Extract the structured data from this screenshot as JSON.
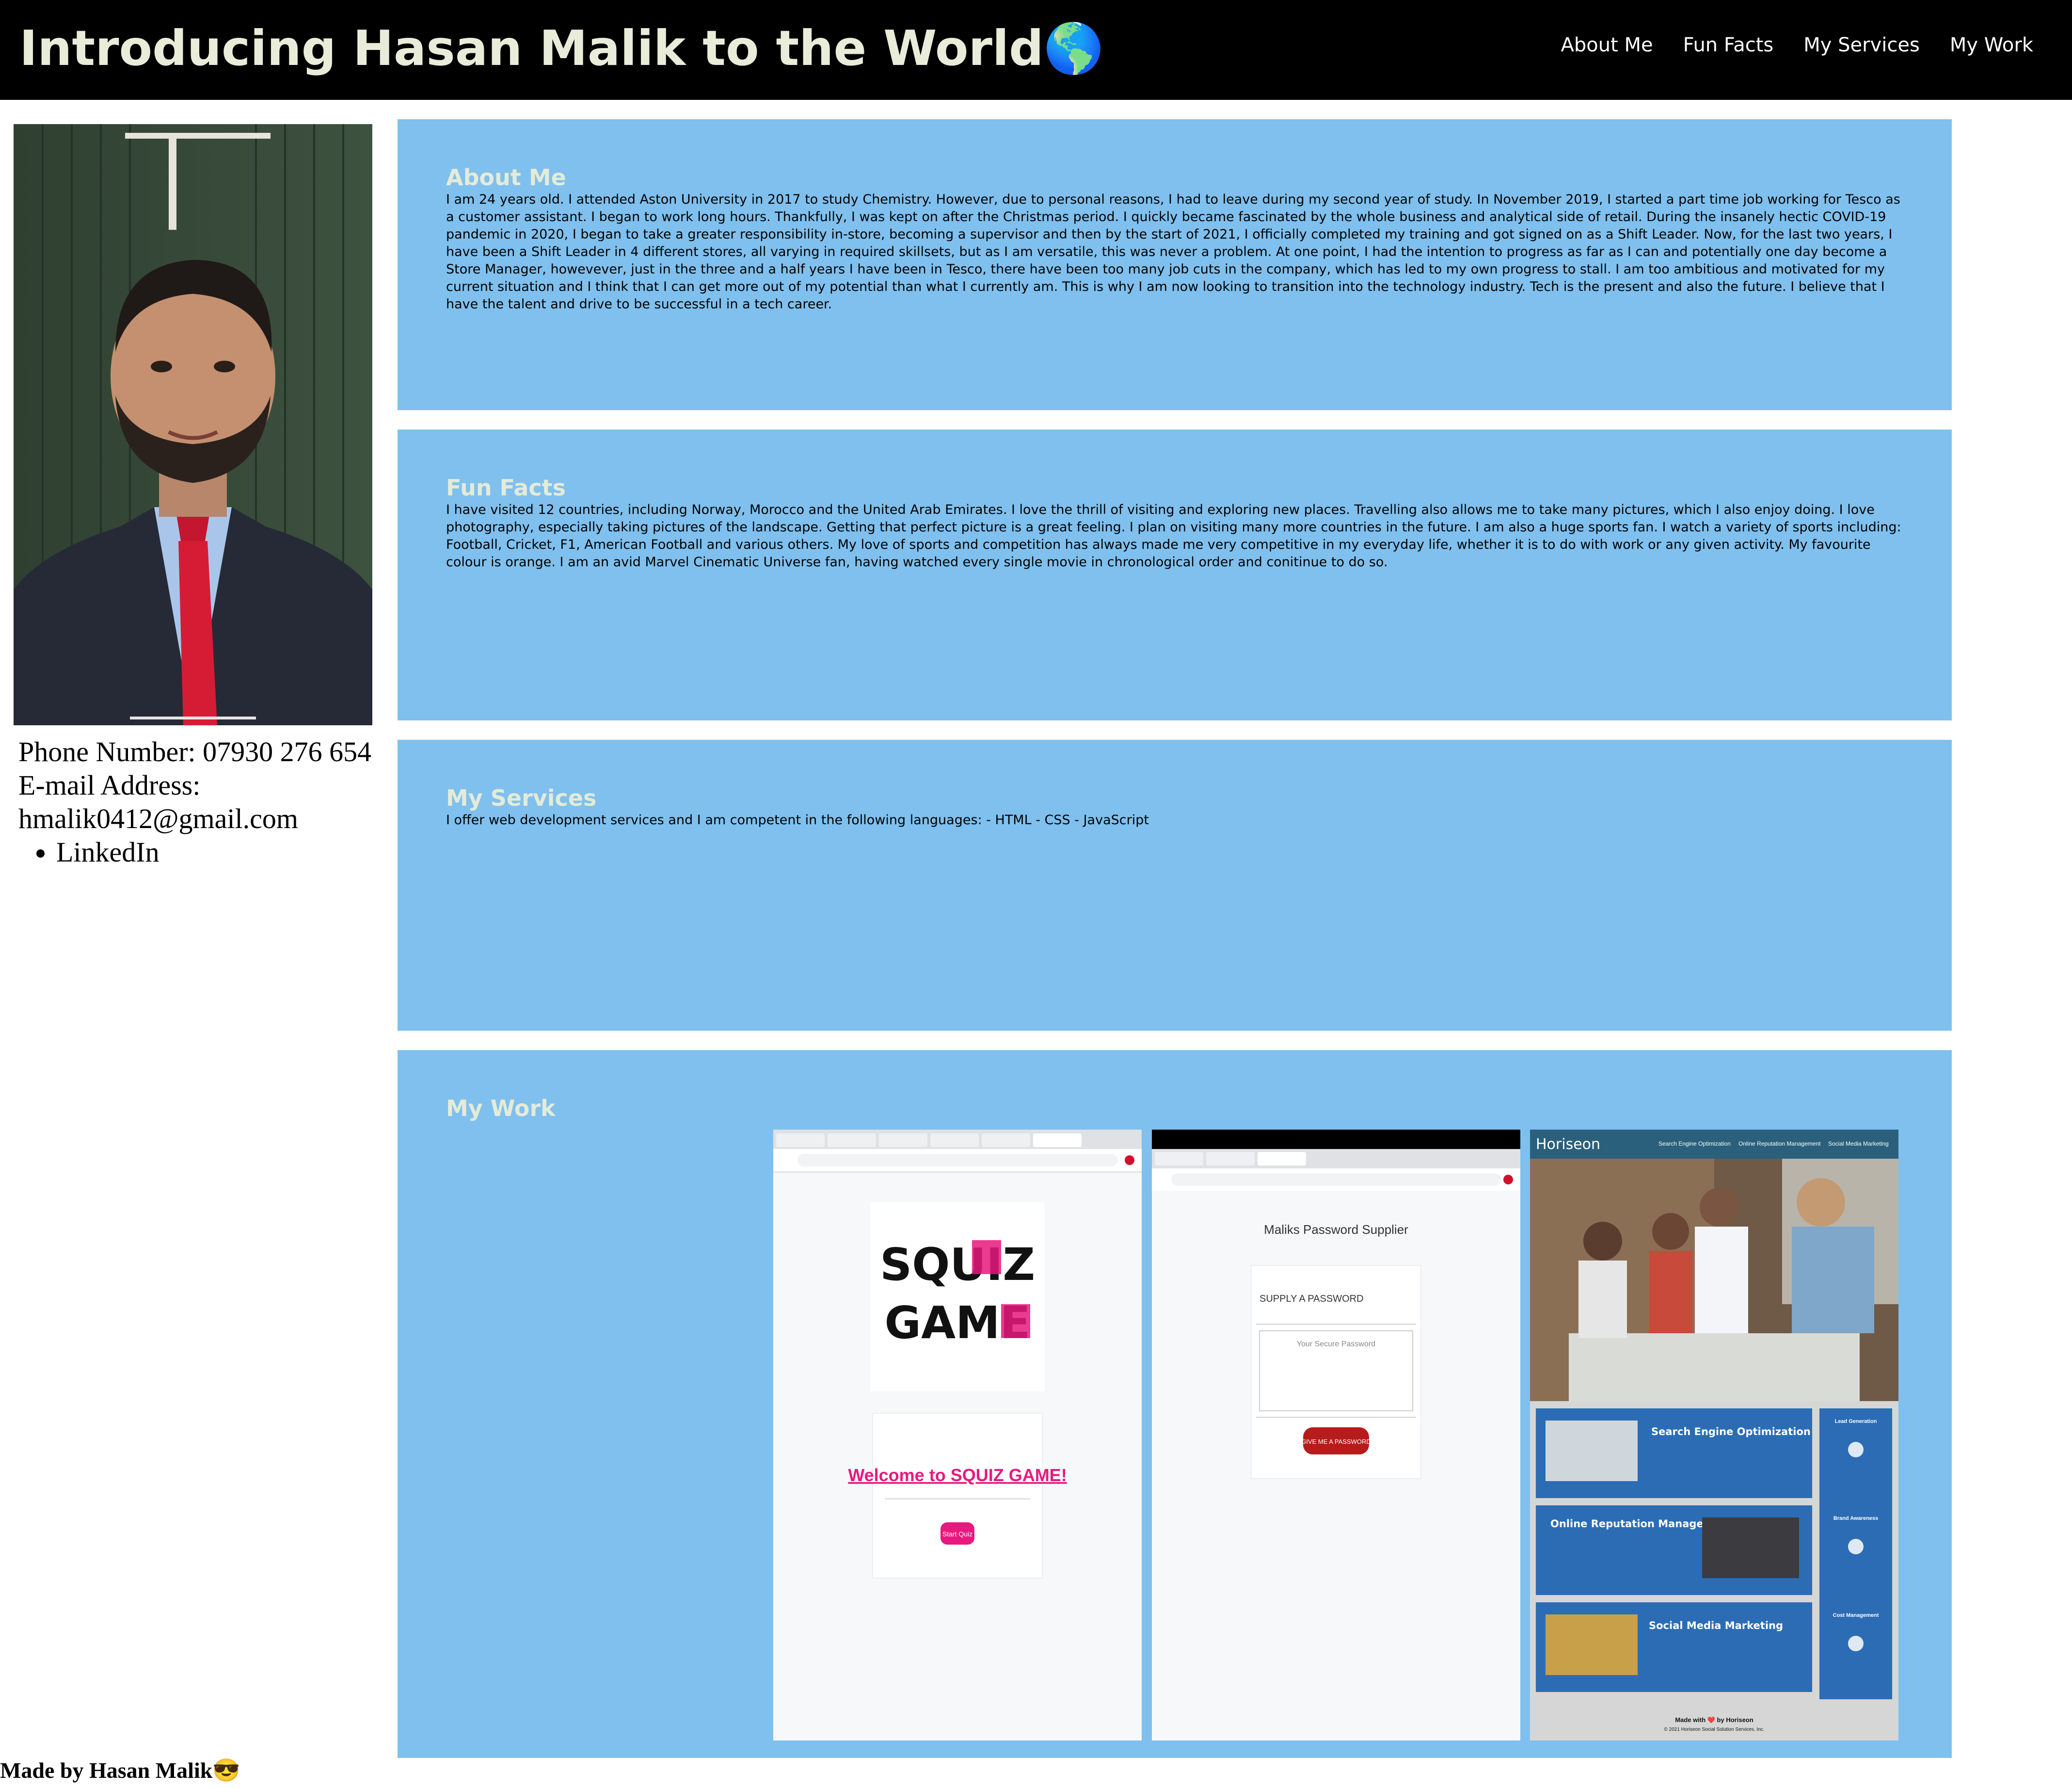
{
  "header": {
    "title": "Introducing Hasan Malik to the World🌎",
    "nav": [
      "About Me",
      "Fun Facts",
      "My Services",
      "My Work"
    ]
  },
  "sidebar": {
    "contact_text": "Phone Number: 07930 276 654 E-mail Address: hmalik0412@gmail.com",
    "links": [
      "LinkedIn"
    ]
  },
  "sections": {
    "about": {
      "heading": "About Me",
      "text": "I am 24 years old. I attended Aston University in 2017 to study Chemistry. However, due to personal reasons, I had to leave during my second year of study. In November 2019, I started a part time job working for Tesco as a customer assistant. I began to work long hours. Thankfully, I was kept on after the Christmas period. I quickly became fascinated by the whole business and analytical side of retail. During the insanely hectic COVID-19 pandemic in 2020, I began to take a greater responsibility in-store, becoming a supervisor and then by the start of 2021, I officially completed my training and got signed on as a Shift Leader. Now, for the last two years, I have been a Shift Leader in 4 different stores, all varying in required skillsets, but as I am versatile, this was never a problem. At one point, I had the intention to progress as far as I can and potentially one day become a Store Manager, howevever, just in the three and a half years I have been in Tesco, there have been too many job cuts in the company, which has led to my own progress to stall. I am too ambitious and motivated for my current situation and I think that I can get more out of my potential than what I currently am. This is why I am now looking to transition into the technology industry. Tech is the present and also the future. I believe that I have the talent and drive to be successful in a tech career."
    },
    "facts": {
      "heading": "Fun Facts",
      "text": "I have visited 12 countries, including Norway, Morocco and the United Arab Emirates. I love the thrill of visiting and exploring new places. Travelling also allows me to take many pictures, which I also enjoy doing. I love photography, especially taking pictures of the landscape. Getting that perfect picture is a great feeling. I plan on visiting many more countries in the future. I am also a huge sports fan. I watch a variety of sports including: Football, Cricket, F1, American Football and various others. My love of sports and competition has always made me very competitive in my everyday life, whether it is to do with work or any given activity. My favourite colour is orange. I am an avid Marvel Cinematic Universe fan, having watched every single movie in chronological order and conitinue to do so."
    },
    "services": {
      "heading": "My Services",
      "text": "I offer web development services and I am competent in the following languages: - HTML - CSS - JavaScript"
    },
    "work": {
      "heading": "My Work"
    }
  },
  "work_thumbs": {
    "squiz": {
      "logo_line1": "SQUIZ",
      "logo_line2": "GAME",
      "welcome": "Welcome to SQUIZ GAME!",
      "button": "Start Quiz"
    },
    "password": {
      "title": "Maliks Password Supplier",
      "card_heading": "SUPPLY A PASSWORD",
      "placeholder": "Your Secure Password",
      "button": "GIVE ME A PASSWORD"
    },
    "horiseon": {
      "brand": "Horiseon",
      "nav": [
        "Search Engine Optimization",
        "Online Reputation Management",
        "Social Media Marketing"
      ],
      "card1": "Search Engine Optimization",
      "card2": "Online Reputation Management",
      "card3": "Social Media Marketing",
      "side1": "Lead Generation",
      "side2": "Brand Awareness",
      "side3": "Cost Management",
      "footer": "Made with ❤️ by Horiseon",
      "copyright": "© 2021 Horiseon Social Solution Services, Inc."
    }
  },
  "footer": {
    "text": "Made by Hasan Malik😎"
  },
  "colors": {
    "header_bg": "#000000",
    "title": "#e9ecd9",
    "section_bg": "#7fc0ee",
    "section_heading": "#e4ebd8",
    "squiz_pink": "#e8197e",
    "password_red": "#b71c1c",
    "horiseon_header": "#2a607c",
    "horiseon_card": "#2b6cb5"
  }
}
